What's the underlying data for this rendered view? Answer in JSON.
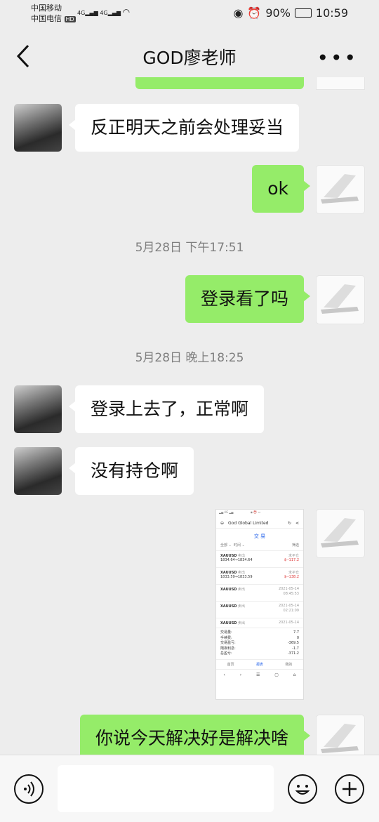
{
  "status": {
    "carrier1": "中国移动",
    "carrier2": "中国电信",
    "hd": "HD",
    "net1": "4G",
    "net2": "4G",
    "battery": "90%",
    "time": "10:59"
  },
  "header": {
    "title": "GOD廖老师"
  },
  "messages": {
    "m1": "反正明天之前会处理妥当",
    "m2": "ok",
    "t1": "5月28日 下午17:51",
    "m3": "登录看了吗",
    "t2": "5月28日 晚上18:25",
    "m4": "登录上去了，正常啊",
    "m5": "没有持仓啊",
    "m6": "你说今天解决好是解决啥"
  },
  "screenshot": {
    "app": "God Global Limited",
    "title": "交 易",
    "filter_all": "全部 ⌄",
    "filter_time": "时间 ⌄",
    "filter_right": "筛选",
    "rows": [
      {
        "sym": "XAUUSD",
        "side": "卖出",
        "state": "未平仓",
        "price": "1834.64→1834.64",
        "pl": "$--117.2"
      },
      {
        "sym": "XAUUSD",
        "side": "卖出",
        "state": "未平仓",
        "price": "1833.59→1833.59",
        "pl": "$--138.2"
      },
      {
        "sym": "XAUUSD",
        "side": "卖出",
        "date": "2021-05-14",
        "time": "08:45:53"
      },
      {
        "sym": "XAUUSD",
        "side": "卖出",
        "date": "2021-05-14",
        "time": "02:21:09"
      },
      {
        "sym": "XAUUSD",
        "side": "卖出",
        "date": "2021-05-14",
        "time": ""
      }
    ],
    "summary": [
      {
        "k": "交易量:",
        "v": "7.7"
      },
      {
        "k": "手续费:",
        "v": "0"
      },
      {
        "k": "交易盈亏:",
        "v": "-369.5"
      },
      {
        "k": "隔夜利息:",
        "v": "-1.7"
      },
      {
        "k": "总盈亏:",
        "v": "-371.2"
      }
    ],
    "tabs": [
      "首页",
      "报表",
      "我的"
    ]
  }
}
